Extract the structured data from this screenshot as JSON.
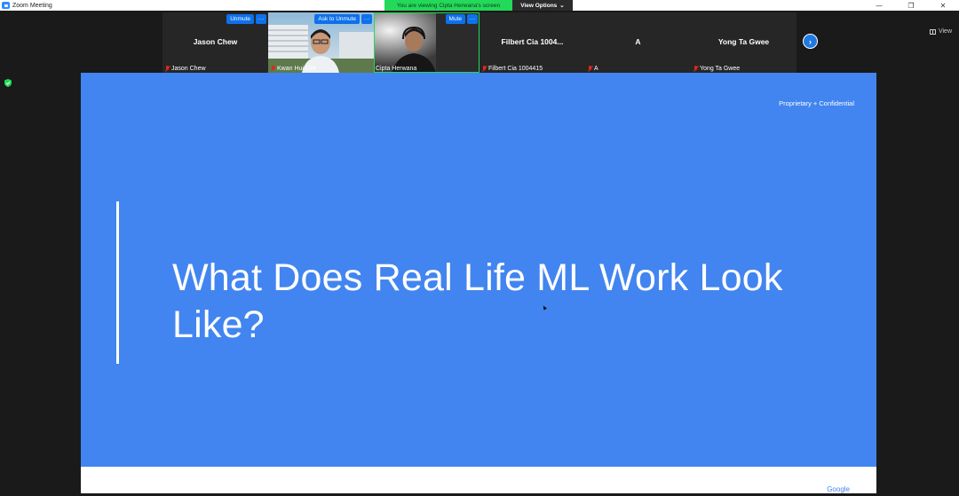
{
  "window": {
    "title": "Zoom Meeting",
    "controls": [
      "—",
      "❐",
      "✕"
    ]
  },
  "banner": {
    "viewing": "You are viewing Cipta Herwana's screen",
    "view_options": "View Options",
    "chevron": "⌄"
  },
  "view_button": "View",
  "participants": [
    {
      "display": "Jason Chew",
      "label": "Jason Chew",
      "muted": true,
      "video": false
    },
    {
      "display": "",
      "label": "Kwan Hui LIM",
      "muted": true,
      "video": true,
      "button": "Ask to Unmute",
      "more": "···"
    },
    {
      "display": "",
      "label": "Cipta Herwana",
      "muted": false,
      "video": true,
      "button": "Mute",
      "more": "···",
      "speaking": true
    },
    {
      "display": "Filbert Cia 1004...",
      "label": "Filbert Cia 1004415",
      "muted": true,
      "video": false
    },
    {
      "display": "A",
      "label": "A",
      "muted": true,
      "video": false
    },
    {
      "display": "Yong Ta Gwee",
      "label": "Yong Ta Gwee",
      "muted": true,
      "video": false
    }
  ],
  "first_tile_buttons": {
    "button": "Unmute",
    "more": "···"
  },
  "next_page": "›",
  "slide": {
    "confidential": "Proprietary + Confidential",
    "title": "What Does Real Life ML Work Look Like?",
    "footer_logo": "Google"
  },
  "colors": {
    "slide_bg": "#4285f0",
    "banner_green": "#23d959",
    "zoom_blue": "#0e71eb"
  }
}
